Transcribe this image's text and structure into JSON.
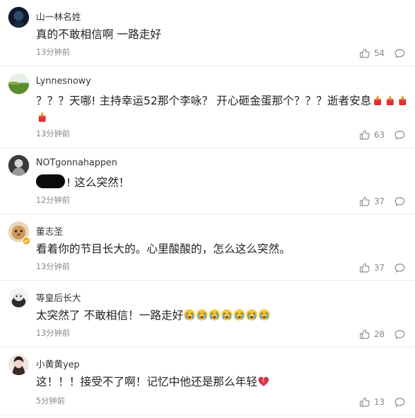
{
  "comments": [
    {
      "username": "山一林名姓",
      "text": "真的不敢相信啊 一路走好",
      "time": "13分钟前",
      "likes": "54"
    },
    {
      "username": "Lynnesnowy",
      "text": "？？？天哪! 主持幸运52那个李咏？ 开心砸金蛋那个？？？逝者安息",
      "time": "13分钟前",
      "likes": "63"
    },
    {
      "username": "NOTgonnahappen",
      "text": "! 这么突然！",
      "time": "12分钟前",
      "likes": "37"
    },
    {
      "username": "董志圣",
      "text": "看着你的节目长大的。心里酸酸的，怎么这么突然。",
      "time": "13分钟前",
      "likes": "37"
    },
    {
      "username": "等皇后长大",
      "text": "太突然了 不敢相信！一路走好",
      "time": "13分钟前",
      "likes": "28"
    },
    {
      "username": "小黄黄yep",
      "text": "这！！！接受不了啊！记忆中他还是那么年轻",
      "time": "5分钟前",
      "likes": "13"
    }
  ],
  "icons": {
    "like": "thumbs-up-icon",
    "reply": "comment-bubble-icon",
    "candle": "candle-emoji-icon",
    "cry": "crying-face-emoji-icon",
    "broken_heart": "broken-heart-emoji-icon",
    "verified": "verified-badge-icon"
  },
  "colors": {
    "text_primary": "#222222",
    "text_meta": "#888888",
    "divider": "#ebebeb",
    "verified_badge": "#f2a41c",
    "broken_heart": "#d9364a"
  }
}
